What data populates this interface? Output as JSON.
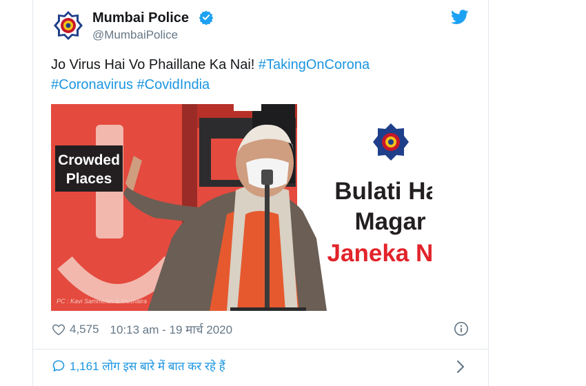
{
  "tweet": {
    "name": "Mumbai Police",
    "handle": "@MumbaiPolice",
    "text_main": "Jo Virus Hai Vo Phaillane Ka Nai! ",
    "hashtags": [
      "#TakingOnCorona",
      "#Coronavirus",
      "#CovidIndia"
    ],
    "likes": "4,575",
    "timestamp": "10:13 am - 19 मार्च 2020",
    "replies_text": "1,161 लोग इस बारे में बात कर रहे हैं"
  },
  "media": {
    "sign_line1": "Crowded",
    "sign_line2": "Places",
    "headline_line1": "Bulati Hai",
    "headline_line2": "Magar",
    "headline_line3": "Janeka Nai",
    "credit": "PC : Kavi Sammelan & Mushaira"
  },
  "colors": {
    "accent": "#1b95e0",
    "verified": "#1da1f2",
    "text_secondary": "#657786",
    "headline_red": "#e2232a",
    "backdrop_red": "#e44a3e"
  },
  "icons": [
    "police-logo-icon",
    "verified-badge-icon",
    "twitter-bird-icon",
    "heart-icon",
    "info-icon",
    "reply-bubble-icon",
    "chevron-right-icon"
  ]
}
